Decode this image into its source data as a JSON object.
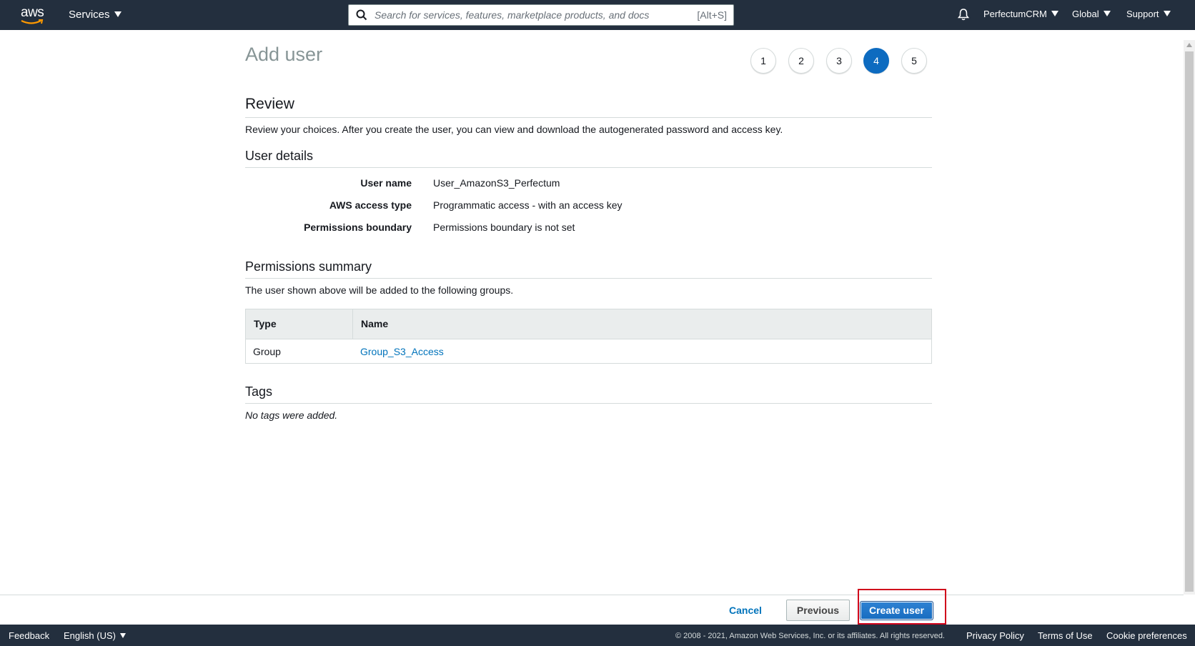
{
  "topnav": {
    "logo_text": "aws",
    "services_label": "Services",
    "search_placeholder": "Search for services, features, marketplace products, and docs",
    "search_shortcut": "[Alt+S]",
    "account_label": "PerfectumCRM",
    "region_label": "Global",
    "support_label": "Support"
  },
  "page": {
    "title": "Add user",
    "steps": [
      "1",
      "2",
      "3",
      "4",
      "5"
    ],
    "active_step": "4"
  },
  "review": {
    "heading": "Review",
    "description": "Review your choices. After you create the user, you can view and download the autogenerated password and access key."
  },
  "user_details": {
    "heading": "User details",
    "rows": [
      {
        "label": "User name",
        "value": "User_AmazonS3_Perfectum"
      },
      {
        "label": "AWS access type",
        "value": "Programmatic access - with an access key"
      },
      {
        "label": "Permissions boundary",
        "value": "Permissions boundary is not set"
      }
    ]
  },
  "permissions": {
    "heading": "Permissions summary",
    "description": "The user shown above will be added to the following groups.",
    "columns": [
      "Type",
      "Name"
    ],
    "rows": [
      {
        "type": "Group",
        "name": "Group_S3_Access"
      }
    ]
  },
  "tags": {
    "heading": "Tags",
    "empty_text": "No tags were added."
  },
  "actions": {
    "cancel_label": "Cancel",
    "previous_label": "Previous",
    "create_label": "Create user"
  },
  "bottombar": {
    "feedback_label": "Feedback",
    "language_label": "English (US)",
    "copyright": "© 2008 - 2021, Amazon Web Services, Inc. or its affiliates. All rights reserved.",
    "privacy_label": "Privacy Policy",
    "terms_label": "Terms of Use",
    "cookie_label": "Cookie preferences"
  },
  "colors": {
    "nav_bg": "#232f3e",
    "accent": "#0d6bc0",
    "link": "#0073bb",
    "highlight": "#d0021b"
  }
}
